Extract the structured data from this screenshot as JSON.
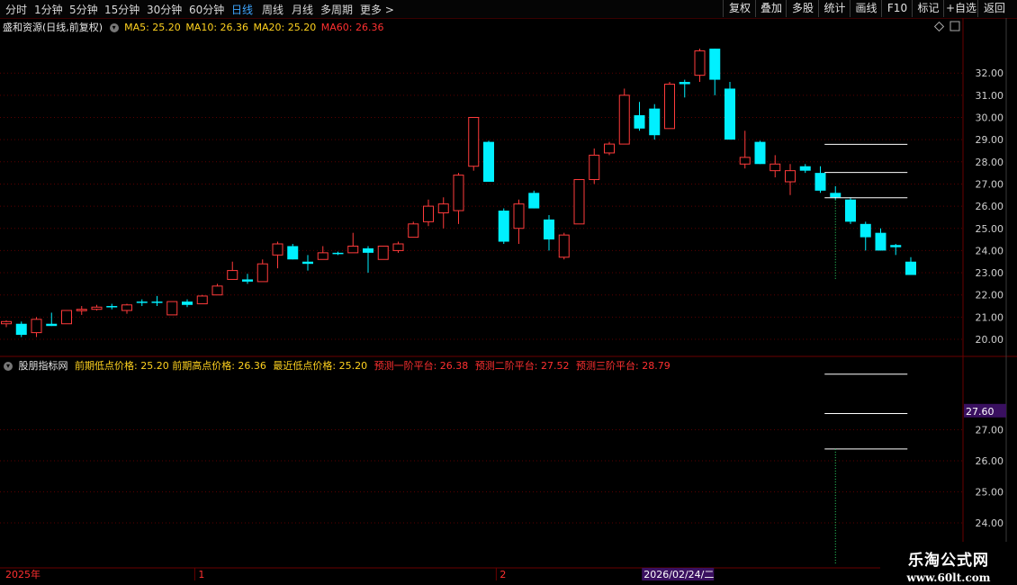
{
  "toolbar": {
    "periods": [
      "分时",
      "1分钟",
      "5分钟",
      "15分钟",
      "30分钟",
      "60分钟",
      "日线",
      "周线",
      "月线",
      "多周期",
      "更多 >"
    ],
    "active_period": "日线",
    "buttons": [
      "复权",
      "叠加",
      "多股",
      "统计",
      "画线",
      "F10",
      "标记",
      "+自选",
      "返回"
    ]
  },
  "main_header": {
    "stock_label": "盛和资源(日线,前复权)",
    "ma5": "MA5: 25.20",
    "ma10": "MA10: 26.36",
    "ma20": "MA20: 25.20",
    "ma60": "MA60: 26.36"
  },
  "sub_header": {
    "indicator_name": "股朋指标网",
    "prev_low": "前期低点价格: 25.20",
    "prev_high": "前期高点价格: 26.36",
    "recent_low": "最近低点价格: 25.20",
    "forecast1": "预测一阶平台: 26.38",
    "forecast2": "预测二阶平台: 27.52",
    "forecast3": "预测三阶平台: 28.79"
  },
  "colors": {
    "up": "#ff3b3b",
    "down": "#00f0ff",
    "grid": "#5a0000",
    "axis_text": "#cfcfcf",
    "platform_line": "#ffffff",
    "yellow": "#ffd21f",
    "green": "#2ee06a",
    "header_red": "#ff3030",
    "cursor_label_bg": "#3a1060"
  },
  "watermark": {
    "line1": "乐淘公式网",
    "line2": "www.60lt.com"
  },
  "chart_data": [
    {
      "type": "candlestick",
      "name": "main",
      "y_ticks": [
        "20.00",
        "21.00",
        "22.00",
        "23.00",
        "24.00",
        "25.00",
        "26.00",
        "27.00",
        "28.00",
        "29.00",
        "30.00",
        "31.00",
        "32.00"
      ],
      "ylim": [
        19.5,
        33.4
      ],
      "x_labels": [
        "2025年",
        "1",
        "2"
      ],
      "x_label_index": [
        0,
        13,
        33
      ],
      "cursor_date": "2026/02/24/二",
      "cursor_index": 55,
      "candles": [
        {
          "o": 20.7,
          "h": 20.85,
          "l": 20.55,
          "c": 20.8
        },
        {
          "o": 20.7,
          "h": 20.8,
          "l": 20.1,
          "c": 20.2
        },
        {
          "o": 20.3,
          "h": 21.0,
          "l": 20.1,
          "c": 20.9
        },
        {
          "o": 20.7,
          "h": 21.2,
          "l": 20.6,
          "c": 20.6
        },
        {
          "o": 20.7,
          "h": 21.3,
          "l": 20.7,
          "c": 21.3
        },
        {
          "o": 21.3,
          "h": 21.5,
          "l": 21.1,
          "c": 21.35
        },
        {
          "o": 21.35,
          "h": 21.55,
          "l": 21.3,
          "c": 21.45
        },
        {
          "o": 21.5,
          "h": 21.6,
          "l": 21.35,
          "c": 21.45
        },
        {
          "o": 21.3,
          "h": 21.6,
          "l": 21.15,
          "c": 21.55
        },
        {
          "o": 21.7,
          "h": 21.8,
          "l": 21.5,
          "c": 21.65
        },
        {
          "o": 21.7,
          "h": 21.95,
          "l": 21.5,
          "c": 21.65
        },
        {
          "o": 21.1,
          "h": 21.7,
          "l": 21.1,
          "c": 21.7
        },
        {
          "o": 21.7,
          "h": 21.8,
          "l": 21.45,
          "c": 21.55
        },
        {
          "o": 21.6,
          "h": 22.0,
          "l": 21.6,
          "c": 21.95
        },
        {
          "o": 22.0,
          "h": 22.5,
          "l": 22.0,
          "c": 22.4
        },
        {
          "o": 22.7,
          "h": 23.5,
          "l": 22.7,
          "c": 23.1
        },
        {
          "o": 22.7,
          "h": 22.95,
          "l": 22.5,
          "c": 22.6
        },
        {
          "o": 22.6,
          "h": 23.6,
          "l": 22.6,
          "c": 23.4
        },
        {
          "o": 23.8,
          "h": 24.4,
          "l": 23.2,
          "c": 24.3
        },
        {
          "o": 24.2,
          "h": 24.3,
          "l": 23.6,
          "c": 23.6
        },
        {
          "o": 23.5,
          "h": 23.8,
          "l": 23.1,
          "c": 23.4
        },
        {
          "o": 23.6,
          "h": 24.2,
          "l": 23.6,
          "c": 23.9
        },
        {
          "o": 23.9,
          "h": 23.95,
          "l": 23.8,
          "c": 23.85
        },
        {
          "o": 23.9,
          "h": 24.8,
          "l": 23.9,
          "c": 24.2
        },
        {
          "o": 24.1,
          "h": 24.2,
          "l": 23.0,
          "c": 23.9
        },
        {
          "o": 23.6,
          "h": 24.2,
          "l": 23.6,
          "c": 24.2
        },
        {
          "o": 24.0,
          "h": 24.4,
          "l": 23.9,
          "c": 24.3
        },
        {
          "o": 24.6,
          "h": 25.3,
          "l": 24.6,
          "c": 25.2
        },
        {
          "o": 25.3,
          "h": 26.3,
          "l": 25.1,
          "c": 26.0
        },
        {
          "o": 25.7,
          "h": 26.4,
          "l": 25.0,
          "c": 26.1
        },
        {
          "o": 25.8,
          "h": 27.5,
          "l": 25.2,
          "c": 27.4
        },
        {
          "o": 27.8,
          "h": 30.0,
          "l": 27.6,
          "c": 30.0
        },
        {
          "o": 28.9,
          "h": 28.95,
          "l": 27.1,
          "c": 27.1
        },
        {
          "o": 25.8,
          "h": 25.9,
          "l": 24.3,
          "c": 24.4
        },
        {
          "o": 25.0,
          "h": 26.3,
          "l": 24.3,
          "c": 26.1
        },
        {
          "o": 26.6,
          "h": 26.7,
          "l": 25.9,
          "c": 25.9
        },
        {
          "o": 25.4,
          "h": 25.6,
          "l": 24.0,
          "c": 24.5
        },
        {
          "o": 23.7,
          "h": 24.8,
          "l": 23.6,
          "c": 24.7
        },
        {
          "o": 25.2,
          "h": 27.2,
          "l": 25.2,
          "c": 27.2
        },
        {
          "o": 27.2,
          "h": 28.6,
          "l": 27.0,
          "c": 28.3
        },
        {
          "o": 28.4,
          "h": 28.9,
          "l": 28.3,
          "c": 28.8
        },
        {
          "o": 28.8,
          "h": 31.3,
          "l": 28.8,
          "c": 31.0
        },
        {
          "o": 30.1,
          "h": 30.7,
          "l": 29.4,
          "c": 29.5
        },
        {
          "o": 30.4,
          "h": 30.6,
          "l": 29.0,
          "c": 29.2
        },
        {
          "o": 29.5,
          "h": 31.6,
          "l": 29.5,
          "c": 31.5
        },
        {
          "o": 31.6,
          "h": 31.7,
          "l": 30.9,
          "c": 31.5
        },
        {
          "o": 31.9,
          "h": 33.1,
          "l": 31.6,
          "c": 33.0
        },
        {
          "o": 33.1,
          "h": 33.1,
          "l": 31.0,
          "c": 31.7
        },
        {
          "o": 31.3,
          "h": 31.6,
          "l": 29.0,
          "c": 29.0
        },
        {
          "o": 27.9,
          "h": 29.4,
          "l": 27.7,
          "c": 28.2
        },
        {
          "o": 28.9,
          "h": 28.95,
          "l": 27.9,
          "c": 27.9
        },
        {
          "o": 27.6,
          "h": 28.3,
          "l": 27.3,
          "c": 27.9
        },
        {
          "o": 27.1,
          "h": 27.9,
          "l": 26.5,
          "c": 27.6
        },
        {
          "o": 27.8,
          "h": 27.9,
          "l": 27.5,
          "c": 27.6
        },
        {
          "o": 27.5,
          "h": 27.8,
          "l": 26.6,
          "c": 26.7
        },
        {
          "o": 26.6,
          "h": 26.9,
          "l": 26.3,
          "c": 26.4
        },
        {
          "o": 26.3,
          "h": 26.4,
          "l": 25.2,
          "c": 25.3
        },
        {
          "o": 25.2,
          "h": 25.3,
          "l": 24.0,
          "c": 24.6
        },
        {
          "o": 24.8,
          "h": 25.0,
          "l": 24.0,
          "c": 24.0
        },
        {
          "o": 24.25,
          "h": 24.3,
          "l": 23.8,
          "c": 24.15
        },
        {
          "o": 23.5,
          "h": 23.7,
          "l": 22.9,
          "c": 22.9
        }
      ],
      "platform_lines": [
        26.38,
        27.52,
        28.79
      ],
      "platform_x_start_index": 55
    },
    {
      "type": "line",
      "name": "indicator",
      "y_ticks": [
        "24.00",
        "25.00",
        "26.00",
        "27.00"
      ],
      "ylim": [
        23.2,
        28.5
      ],
      "series": [
        {
          "name": "预测一阶平台",
          "values": [
            26.38
          ]
        },
        {
          "name": "预测二阶平台",
          "values": [
            27.52
          ]
        },
        {
          "name": "预测三阶平台",
          "values": [
            28.79
          ]
        }
      ],
      "current_value_label": "27.60",
      "current_value": 27.6
    }
  ]
}
